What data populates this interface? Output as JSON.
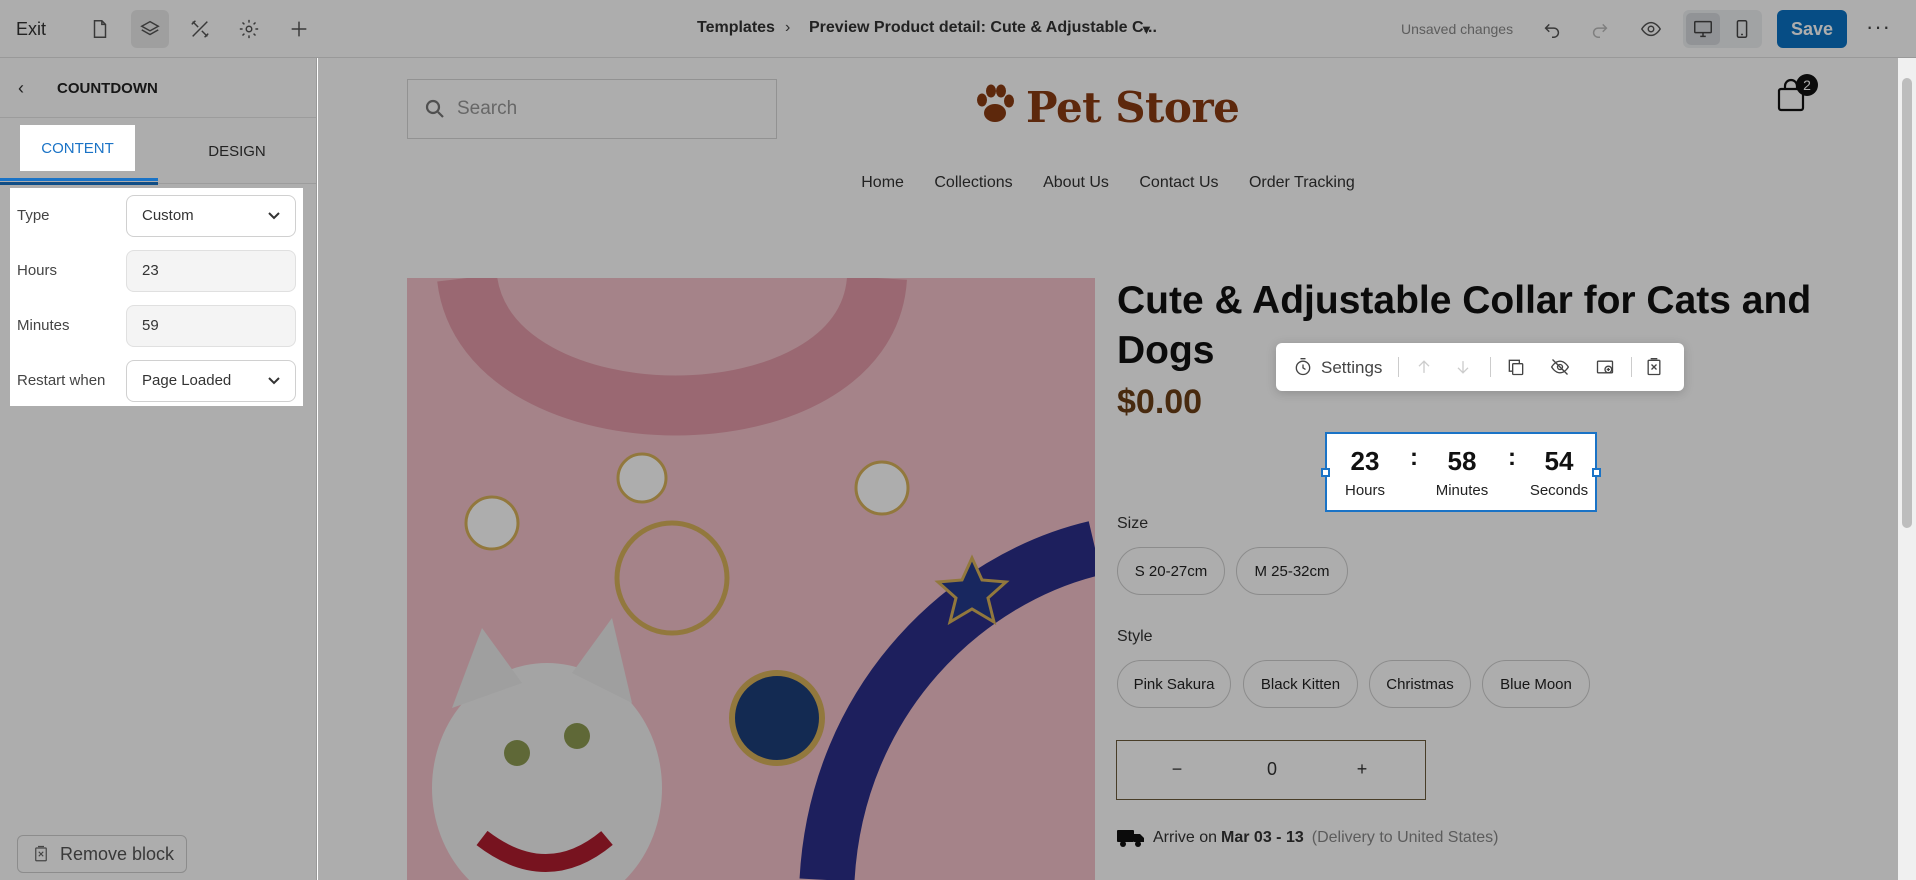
{
  "topbar": {
    "exit_label": "Exit",
    "breadcrumb_root": "Templates",
    "breadcrumb_page": "Preview Product detail: Cute & Adjustable C...",
    "status": "Unsaved changes",
    "save_label": "Save",
    "more_label": "···"
  },
  "panel": {
    "title": "COUNTDOWN",
    "tabs": [
      {
        "label": "CONTENT"
      },
      {
        "label": "DESIGN"
      }
    ],
    "fields": [
      {
        "label": "Type",
        "value": "Custom"
      },
      {
        "label": "Hours",
        "value": "23"
      },
      {
        "label": "Minutes",
        "value": "59"
      },
      {
        "label": "Restart when",
        "value": "Page Loaded"
      }
    ],
    "remove_label": "Remove block"
  },
  "store": {
    "search_placeholder": "Search",
    "logo_text": "Pet Store",
    "cart_count": "2",
    "nav": [
      "Home",
      "Collections",
      "About Us",
      "Contact Us",
      "Order Tracking"
    ],
    "colors": {
      "brand": "#8a3b12",
      "accent": "#1a73c6",
      "save": "#0a72c4"
    }
  },
  "product": {
    "title": "Cute & Adjustable Collar for Cats and Dogs",
    "price": "$0.00",
    "size_label": "Size",
    "sizes": [
      "S 20-27cm",
      "M 25-32cm"
    ],
    "style_label": "Style",
    "styles": [
      "Pink Sakura",
      "Black Kitten",
      "Christmas",
      "Blue Moon"
    ],
    "qty_minus": "−",
    "qty_value": "0",
    "qty_plus": "+",
    "arrive_prefix": "Arrive on",
    "arrive_dates": "Mar 03 - 13",
    "arrive_note": "(Delivery to United States)"
  },
  "block_toolbar": {
    "settings_label": "Settings"
  },
  "countdown": {
    "hours": "23",
    "hours_label": "Hours",
    "sep": ":",
    "minutes": "58",
    "minutes_label": "Minutes",
    "seconds": "54",
    "seconds_label": "Seconds"
  }
}
